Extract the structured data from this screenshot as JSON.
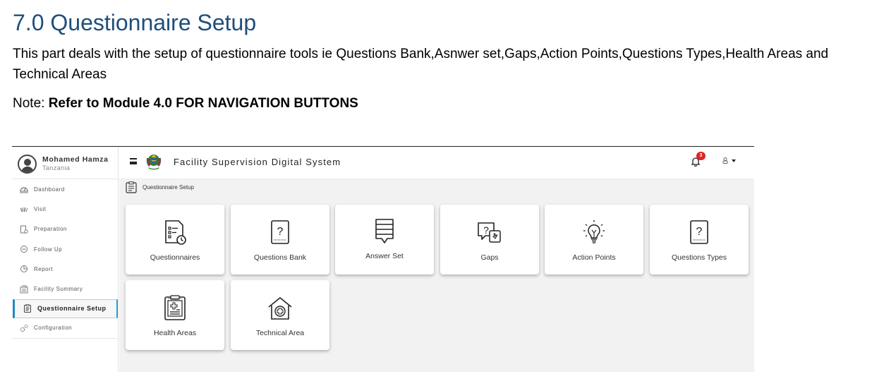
{
  "document": {
    "heading": "7.0 Questionnaire Setup",
    "paragraph": "This part deals with the setup of questionnaire tools ie Questions Bank,Asnwer set,Gaps,Action Points,Questions Types,Health Areas and Technical Areas",
    "note_prefix": "Note: ",
    "note_bold": "Refer to Module 4.0 FOR NAVIGATION BUTTONS"
  },
  "screenshot": {
    "user": {
      "name": "Mohamed Hamza",
      "location": "Tanzania"
    },
    "sidebar": {
      "items": [
        {
          "label": "Dashboard",
          "icon": "dashboard-icon"
        },
        {
          "label": "Visit",
          "icon": "visit-icon"
        },
        {
          "label": "Preparation",
          "icon": "preparation-icon"
        },
        {
          "label": "Follow Up",
          "icon": "follow-up-icon"
        },
        {
          "label": "Report",
          "icon": "report-icon"
        },
        {
          "label": "Facility Summary",
          "icon": "facility-summary-icon"
        },
        {
          "label": "Questionnaire Setup",
          "icon": "clipboard-icon"
        },
        {
          "label": "Configuration",
          "icon": "gears-icon"
        }
      ],
      "active_index": 6
    },
    "topbar": {
      "app_title": "Facility Supervision Digital System",
      "notification_count": "3",
      "badge_color": "#e02424"
    },
    "breadcrumb": "Questionnaire Setup",
    "tiles": [
      {
        "label": "Questionnaires",
        "icon": "questionnaire-icon"
      },
      {
        "label": "Questions Bank",
        "icon": "question-doc-icon"
      },
      {
        "label": "Answer Set",
        "icon": "answer-list-icon"
      },
      {
        "label": "Gaps",
        "icon": "question-cursor-icon"
      },
      {
        "label": "Action Points",
        "icon": "lightbulb-icon"
      },
      {
        "label": "Questions Types",
        "icon": "question-doc-icon"
      },
      {
        "label": "Health Areas",
        "icon": "medical-clipboard-icon"
      },
      {
        "label": "Technical Area",
        "icon": "medical-house-icon"
      }
    ],
    "accent_color": "#1e88c7"
  }
}
